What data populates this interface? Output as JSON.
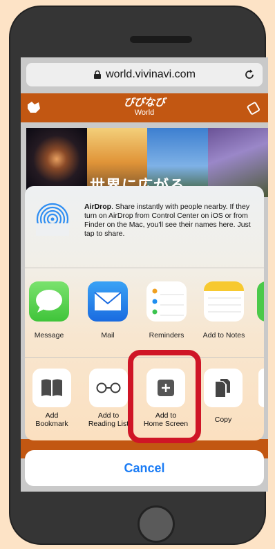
{
  "browser": {
    "url": "world.vivinavi.com"
  },
  "site": {
    "logo": "びびなび",
    "logo_sub": "World",
    "hero_text": "世界に広がる"
  },
  "airdrop": {
    "title": "AirDrop",
    "description": ". Share instantly with people nearby. If they turn on AirDrop from Control Center on iOS or from Finder on the Mac, you'll see their names here. Just tap to share."
  },
  "apps": [
    {
      "label": "Message",
      "icon": "messages-icon"
    },
    {
      "label": "Mail",
      "icon": "mail-icon"
    },
    {
      "label": "Reminders",
      "icon": "reminders-icon"
    },
    {
      "label": "Add to Notes",
      "icon": "notes-icon"
    }
  ],
  "actions": [
    {
      "label_line1": "Add",
      "label_line2": "Bookmark",
      "icon": "book-icon"
    },
    {
      "label_line1": "Add to",
      "label_line2": "Reading List",
      "icon": "glasses-icon"
    },
    {
      "label_line1": "Add to",
      "label_line2": "Home Screen",
      "icon": "plus-square-icon"
    },
    {
      "label_line1": "Copy",
      "label_line2": "",
      "icon": "copy-icon"
    }
  ],
  "cancel_label": "Cancel",
  "colors": {
    "background": "#fde3c6",
    "header": "#c25712",
    "highlight": "#cf1526",
    "ios_blue": "#1b7cf5"
  }
}
